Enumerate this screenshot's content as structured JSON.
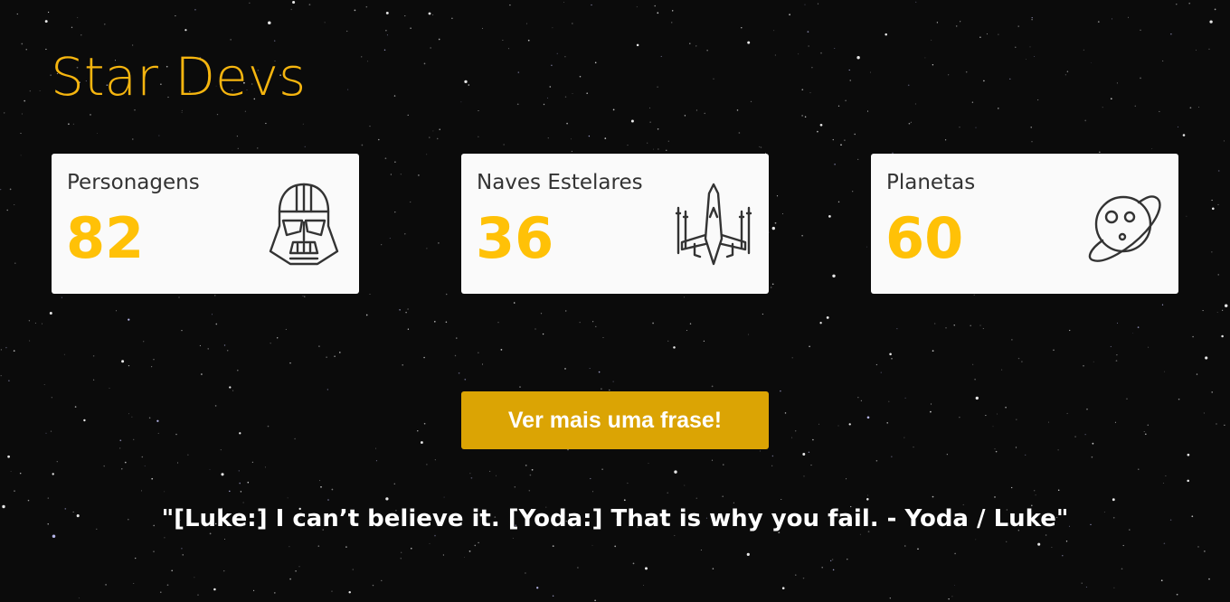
{
  "app": {
    "title": "Star Devs"
  },
  "cards": [
    {
      "label": "Personagens",
      "count": "82",
      "icon": "darth-vader-helmet-icon"
    },
    {
      "label": "Naves Estelares",
      "count": "36",
      "icon": "x-wing-starship-icon"
    },
    {
      "label": "Planetas",
      "count": "60",
      "icon": "planet-icon"
    }
  ],
  "actions": {
    "more_quote_label": "Ver mais uma frase!"
  },
  "quote": {
    "text": "\"[Luke:] I can’t believe it. [Yoda:] That is why you fail. - Yoda / Luke\""
  },
  "colors": {
    "accent": "#f5b50f",
    "count": "#ffc107",
    "button": "#dba404",
    "background": "#0b0b0b",
    "card": "#fafafa",
    "icon_stroke": "#333333"
  }
}
